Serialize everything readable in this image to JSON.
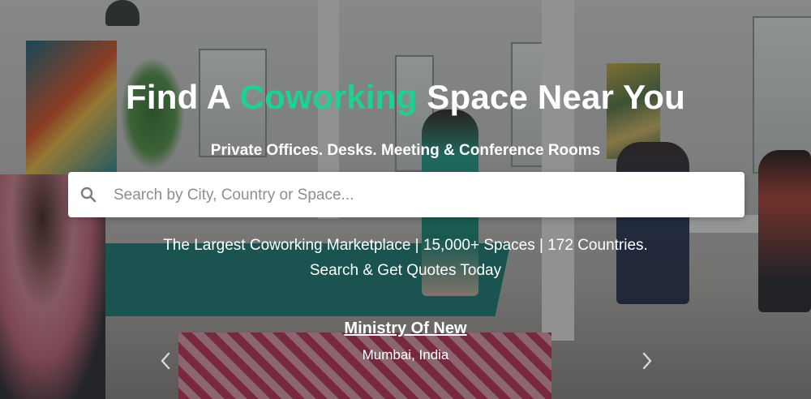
{
  "hero": {
    "title_prefix": "Find A ",
    "title_accent": "Coworking",
    "title_suffix": " Space Near You",
    "subtitle": "Private Offices. Desks. Meeting & Conference Rooms",
    "accent_color": "#1fd090"
  },
  "search": {
    "placeholder": "Search by City, Country or Space...",
    "value": "",
    "icon": "search-icon"
  },
  "tagline": {
    "line1": "The Largest Coworking Marketplace | 15,000+ Spaces | 172 Countries.",
    "line2": "Search & Get Quotes Today"
  },
  "featured": {
    "name": "Ministry Of New",
    "location": "Mumbai, India"
  },
  "carousel": {
    "prev_icon": "chevron-left-icon",
    "next_icon": "chevron-right-icon"
  }
}
